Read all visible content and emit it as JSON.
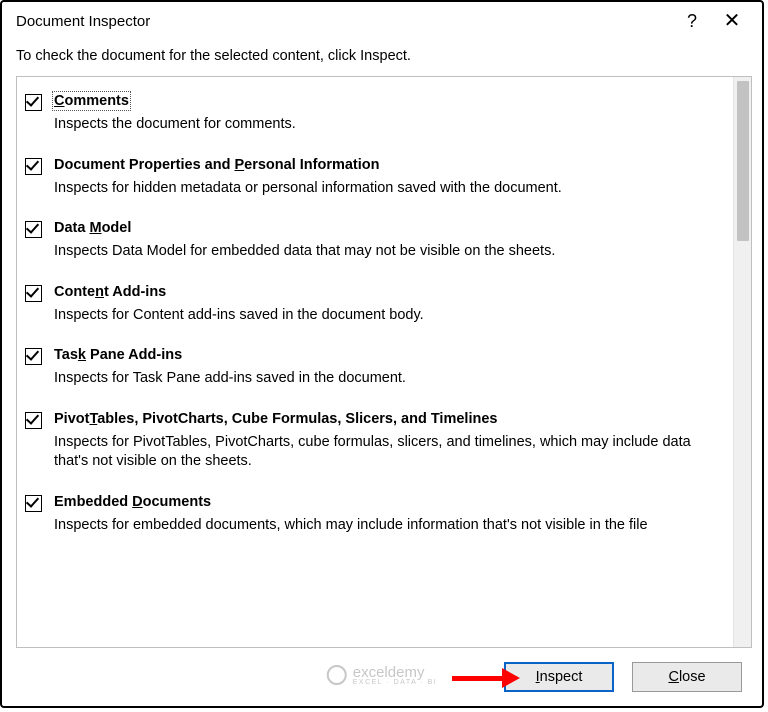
{
  "dialog": {
    "title": "Document Inspector",
    "instruction": "To check the document for the selected content, click Inspect."
  },
  "items": [
    {
      "title_pre": "",
      "title_u": "C",
      "title_post": "omments",
      "checked": true,
      "focused": true,
      "desc": "Inspects the document for comments."
    },
    {
      "title_pre": "Document Properties and ",
      "title_u": "P",
      "title_post": "ersonal Information",
      "checked": true,
      "focused": false,
      "desc": "Inspects for hidden metadata or personal information saved with the document."
    },
    {
      "title_pre": "Data ",
      "title_u": "M",
      "title_post": "odel",
      "checked": true,
      "focused": false,
      "desc": "Inspects Data Model for embedded data that may not be visible on the sheets."
    },
    {
      "title_pre": "Conte",
      "title_u": "n",
      "title_post": "t Add-ins",
      "checked": true,
      "focused": false,
      "desc": "Inspects for Content add-ins saved in the document body."
    },
    {
      "title_pre": "Tas",
      "title_u": "k",
      "title_post": " Pane Add-ins",
      "checked": true,
      "focused": false,
      "desc": "Inspects for Task Pane add-ins saved in the document."
    },
    {
      "title_pre": "Pivot",
      "title_u": "T",
      "title_post": "ables, PivotCharts, Cube Formulas, Slicers, and Timelines",
      "checked": true,
      "focused": false,
      "desc": "Inspects for PivotTables, PivotCharts, cube formulas, slicers, and timelines, which may include data that's not visible on the sheets."
    },
    {
      "title_pre": "Embedded ",
      "title_u": "D",
      "title_post": "ocuments",
      "checked": true,
      "focused": false,
      "desc": "Inspects for embedded documents, which may include information that's not visible in the file"
    }
  ],
  "buttons": {
    "inspect_pre": "",
    "inspect_u": "I",
    "inspect_post": "nspect",
    "close_pre": "",
    "close_u": "C",
    "close_post": "lose"
  },
  "watermark": {
    "brand": "exceldemy",
    "sub": "EXCEL · DATA · BI"
  }
}
